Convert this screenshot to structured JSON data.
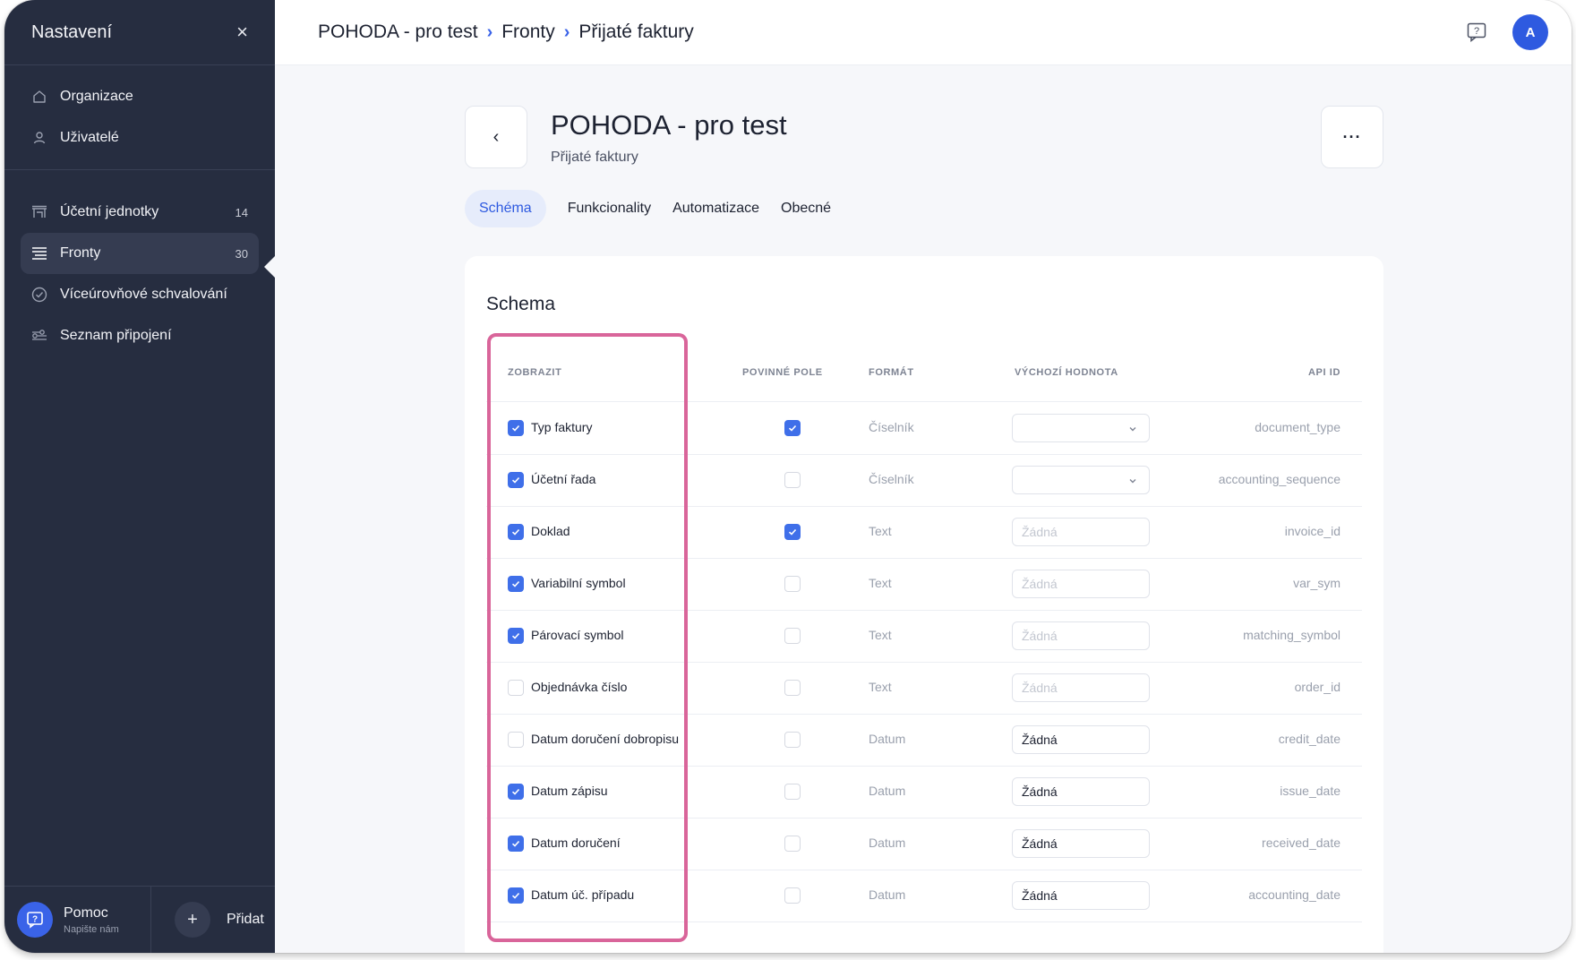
{
  "sidebar": {
    "title": "Nastavení",
    "close_icon": "×",
    "group1": [
      {
        "label": "Organizace",
        "icon": "home-icon"
      },
      {
        "label": "Uživatelé",
        "icon": "user-icon"
      }
    ],
    "group2": [
      {
        "label": "Účetní jednotky",
        "count": "14",
        "icon": "building-icon"
      },
      {
        "label": "Fronty",
        "count": "30",
        "icon": "queue-icon",
        "active": true
      },
      {
        "label": "Víceúrovňové schvalování",
        "icon": "check-circle-icon"
      },
      {
        "label": "Seznam připojení",
        "icon": "connections-icon"
      }
    ],
    "footer": {
      "help_title": "Pomoc",
      "help_sub": "Napište nám",
      "add_symbol": "+",
      "add_label": "Přidat"
    }
  },
  "topbar": {
    "breadcrumbs": [
      "POHODA - pro test",
      "Fronty",
      "Přijaté faktury"
    ],
    "separator": "›",
    "avatar_initial": "A"
  },
  "header": {
    "back_symbol": "‹",
    "title": "POHODA - pro test",
    "subtitle": "Přijaté faktury",
    "more_symbol": "···"
  },
  "tabs": [
    "Schéma",
    "Funkcionality",
    "Automatizace",
    "Obecné"
  ],
  "schema": {
    "title": "Schema",
    "columns": {
      "show": "ZOBRAZIT",
      "required": "POVINNÉ POLE",
      "format": "FORMÁT",
      "default": "VÝCHOZÍ HODNOTA",
      "api_id": "API ID"
    },
    "rows": [
      {
        "label": "Typ faktury",
        "show": true,
        "required": true,
        "format": "Číselník",
        "default": "",
        "default_type": "select",
        "api_id": "document_type"
      },
      {
        "label": "Účetní řada",
        "show": true,
        "required": false,
        "format": "Číselník",
        "default": "",
        "default_type": "select",
        "api_id": "accounting_sequence"
      },
      {
        "label": "Doklad",
        "show": true,
        "required": true,
        "format": "Text",
        "default": "Žádná",
        "default_type": "placeholder",
        "api_id": "invoice_id"
      },
      {
        "label": "Variabilní symbol",
        "show": true,
        "required": false,
        "format": "Text",
        "default": "Žádná",
        "default_type": "placeholder",
        "api_id": "var_sym"
      },
      {
        "label": "Párovací symbol",
        "show": true,
        "required": false,
        "format": "Text",
        "default": "Žádná",
        "default_type": "placeholder",
        "api_id": "matching_symbol"
      },
      {
        "label": "Objednávka číslo",
        "show": false,
        "required": false,
        "format": "Text",
        "default": "Žádná",
        "default_type": "placeholder",
        "api_id": "order_id"
      },
      {
        "label": "Datum doručení dobropisu",
        "show": false,
        "required": false,
        "format": "Datum",
        "default": "Žádná",
        "default_type": "value",
        "api_id": "credit_date"
      },
      {
        "label": "Datum zápisu",
        "show": true,
        "required": false,
        "format": "Datum",
        "default": "Žádná",
        "default_type": "value",
        "api_id": "issue_date"
      },
      {
        "label": "Datum doručení",
        "show": true,
        "required": false,
        "format": "Datum",
        "default": "Žádná",
        "default_type": "value",
        "api_id": "received_date"
      },
      {
        "label": "Datum úč. případu",
        "show": true,
        "required": false,
        "format": "Datum",
        "default": "Žádná",
        "default_type": "value",
        "api_id": "accounting_date"
      }
    ]
  },
  "colors": {
    "sidebar_bg": "#262d40",
    "accent": "#2e5ae0",
    "checkbox_on": "#3f6fe9",
    "highlight": "#d9659a"
  }
}
